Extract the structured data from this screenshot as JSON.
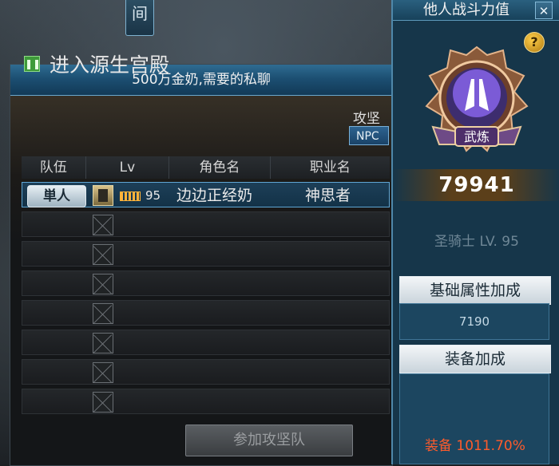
{
  "top_tab": {
    "label": "间"
  },
  "window": {
    "title": "500万金奶,需要的私聊",
    "dungeon_name": "进入源生宫殿",
    "attack_label": "攻坚",
    "npc_button": "NPC"
  },
  "table": {
    "headers": [
      "队伍",
      "Lv",
      "角色名",
      "职业名"
    ],
    "rows": [
      {
        "team": "単人",
        "level": "95",
        "name": "边边正经奶",
        "job": "神思者"
      }
    ],
    "empty_rows": 7
  },
  "join_button": "参加攻坚队",
  "panel": {
    "title": "他人战斗力值",
    "close_label": "✕",
    "help_label": "?",
    "emblem_label": "武炼",
    "power_value": "79941",
    "class_line": "圣骑士 LV. 95",
    "base_stats_title": "基础属性加成",
    "base_stats_value": "7190",
    "equip_title": "装备加成",
    "equip_line": "装备 1011.70%"
  },
  "colors": {
    "accent_blue": "#1c4f72",
    "power_text": "#ffffff",
    "equip_red": "#ff5b2b"
  }
}
